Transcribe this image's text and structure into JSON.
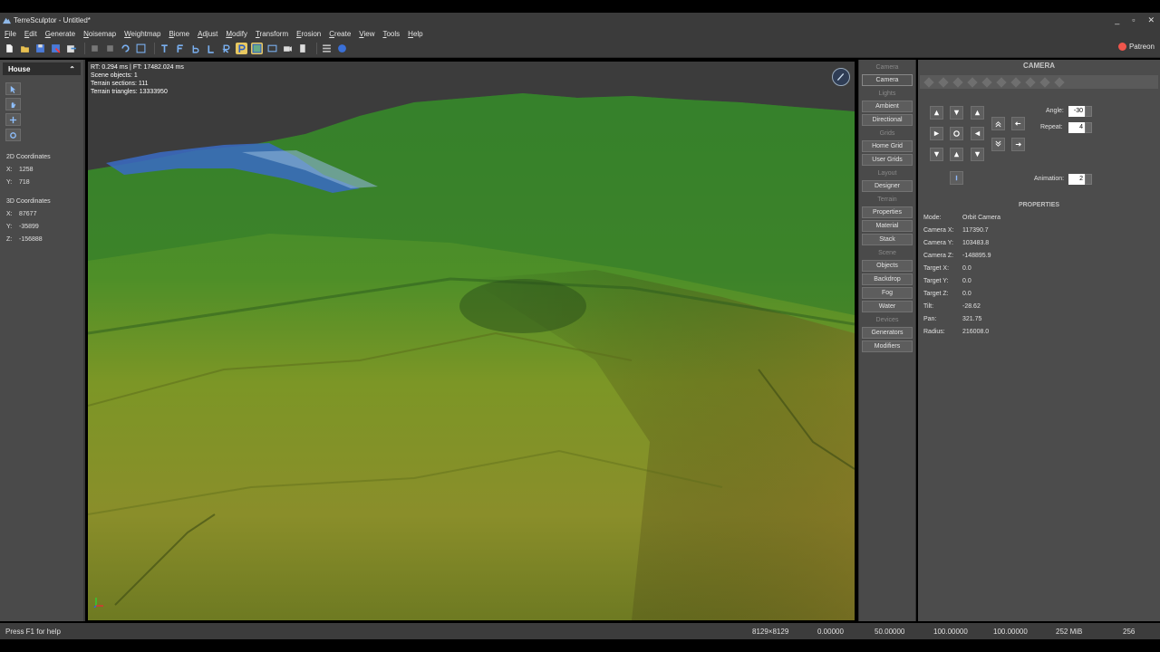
{
  "window": {
    "title": "TerreSculptor - Untitled*",
    "controls": [
      "_",
      "▫",
      "✕"
    ]
  },
  "menu": [
    "File",
    "Edit",
    "Generate",
    "Noisemap",
    "Weightmap",
    "Biome",
    "Adjust",
    "Modify",
    "Transform",
    "Erosion",
    "Create",
    "View",
    "Tools",
    "Help"
  ],
  "toolbar": {
    "patreon_label": "Patreon",
    "accent_active": "#e8c860"
  },
  "left_panel": {
    "title": "House",
    "coords2d_label": "2D Coordinates",
    "coords2d": [
      {
        "k": "X:",
        "v": "1258"
      },
      {
        "k": "Y:",
        "v": "718"
      }
    ],
    "coords3d_label": "3D Coordinates",
    "coords3d": [
      {
        "k": "X:",
        "v": "87677"
      },
      {
        "k": "Y:",
        "v": "-35899"
      },
      {
        "k": "Z:",
        "v": "-156888"
      }
    ]
  },
  "viewport": {
    "stats": [
      "RT: 0.294 ms | FT: 17482.024 ms",
      "Scene objects: 1",
      "Terrain sections: 111",
      "Terrain triangles: 13333950"
    ]
  },
  "mid_panel": {
    "sections": [
      {
        "title": "Camera",
        "buttons": [
          "Camera"
        ]
      },
      {
        "title": "Lights",
        "buttons": [
          "Ambient",
          "Directional"
        ]
      },
      {
        "title": "Grids",
        "buttons": [
          "Home Grid",
          "User Grids"
        ]
      },
      {
        "title": "Layout",
        "buttons": [
          "Designer"
        ]
      },
      {
        "title": "Terrain",
        "buttons": [
          "Properties",
          "Material",
          "Stack"
        ]
      },
      {
        "title": "Scene",
        "buttons": [
          "Objects",
          "Backdrop",
          "Fog",
          "Water"
        ]
      },
      {
        "title": "Devices",
        "buttons": [
          "Generators",
          "Modifiers"
        ]
      }
    ]
  },
  "right_panel": {
    "title": "CAMERA",
    "angle_label": "Angle:",
    "angle_value": "-30",
    "repeat_label": "Repeat:",
    "repeat_value": "4",
    "animation_label": "Animation:",
    "animation_value": "2",
    "properties_title": "PROPERTIES",
    "properties": [
      {
        "k": "Mode:",
        "v": "Orbit Camera"
      },
      {
        "k": "Camera X:",
        "v": "117390.7"
      },
      {
        "k": "Camera Y:",
        "v": "103483.8"
      },
      {
        "k": "Camera Z:",
        "v": "-148895.9"
      },
      {
        "k": "Target X:",
        "v": "0.0"
      },
      {
        "k": "Target Y:",
        "v": "0.0"
      },
      {
        "k": "Target Z:",
        "v": "0.0"
      },
      {
        "k": "Tilt:",
        "v": "-28.62"
      },
      {
        "k": "Pan:",
        "v": "321.75"
      },
      {
        "k": "Radius:",
        "v": "216008.0"
      }
    ]
  },
  "status": {
    "help": "Press F1 for help",
    "cells": [
      "8129×8129",
      "0.00000",
      "50.00000",
      "100.00000",
      "100.00000",
      "252 MiB",
      "256"
    ]
  }
}
